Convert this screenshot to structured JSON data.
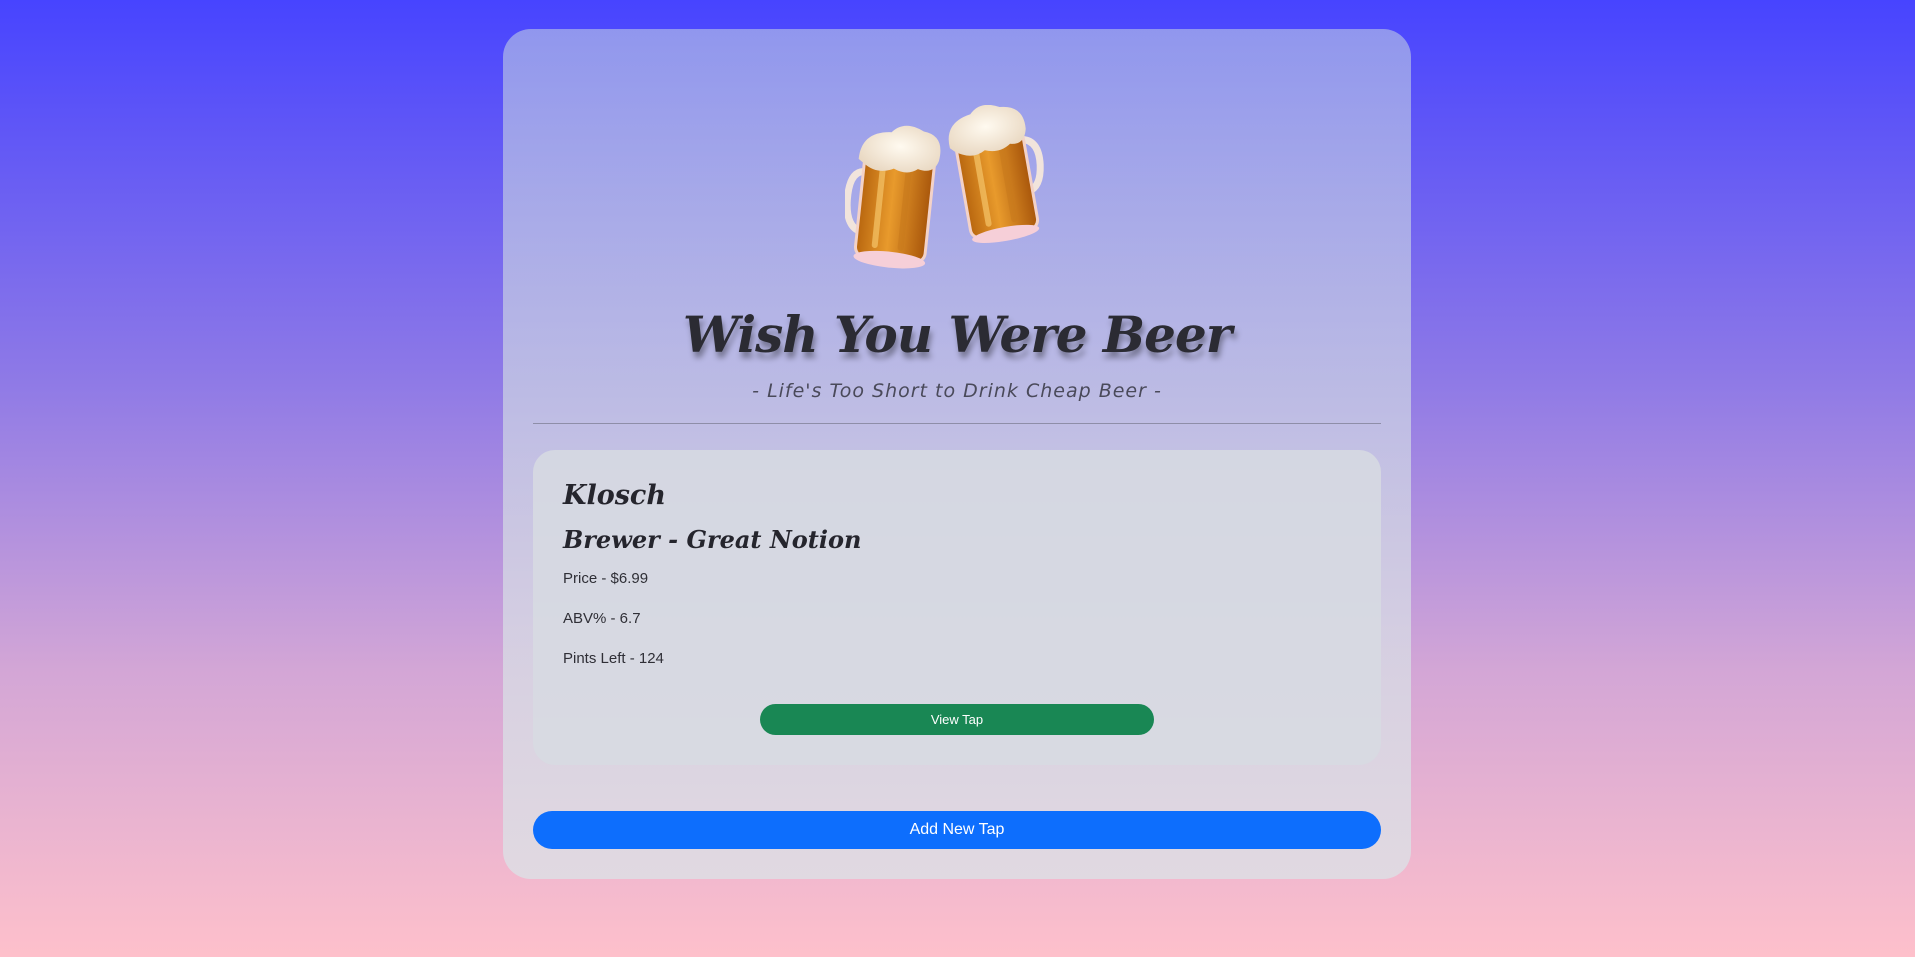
{
  "header": {
    "hero_icon": "beer-mugs-clinking-icon",
    "title": "Wish You Were Beer",
    "subtitle": "- Life's Too Short to Drink Cheap Beer -"
  },
  "taps": [
    {
      "name": "Klosch",
      "brewer": "Brewer - Great Notion",
      "price": "Price - $6.99",
      "abv": "ABV% - 6.7",
      "pints_left": "Pints Left - 124",
      "view_label": "View Tap"
    }
  ],
  "actions": {
    "add_label": "Add New Tap"
  },
  "colors": {
    "view_button": "#198754",
    "add_button": "#0d6efd"
  }
}
